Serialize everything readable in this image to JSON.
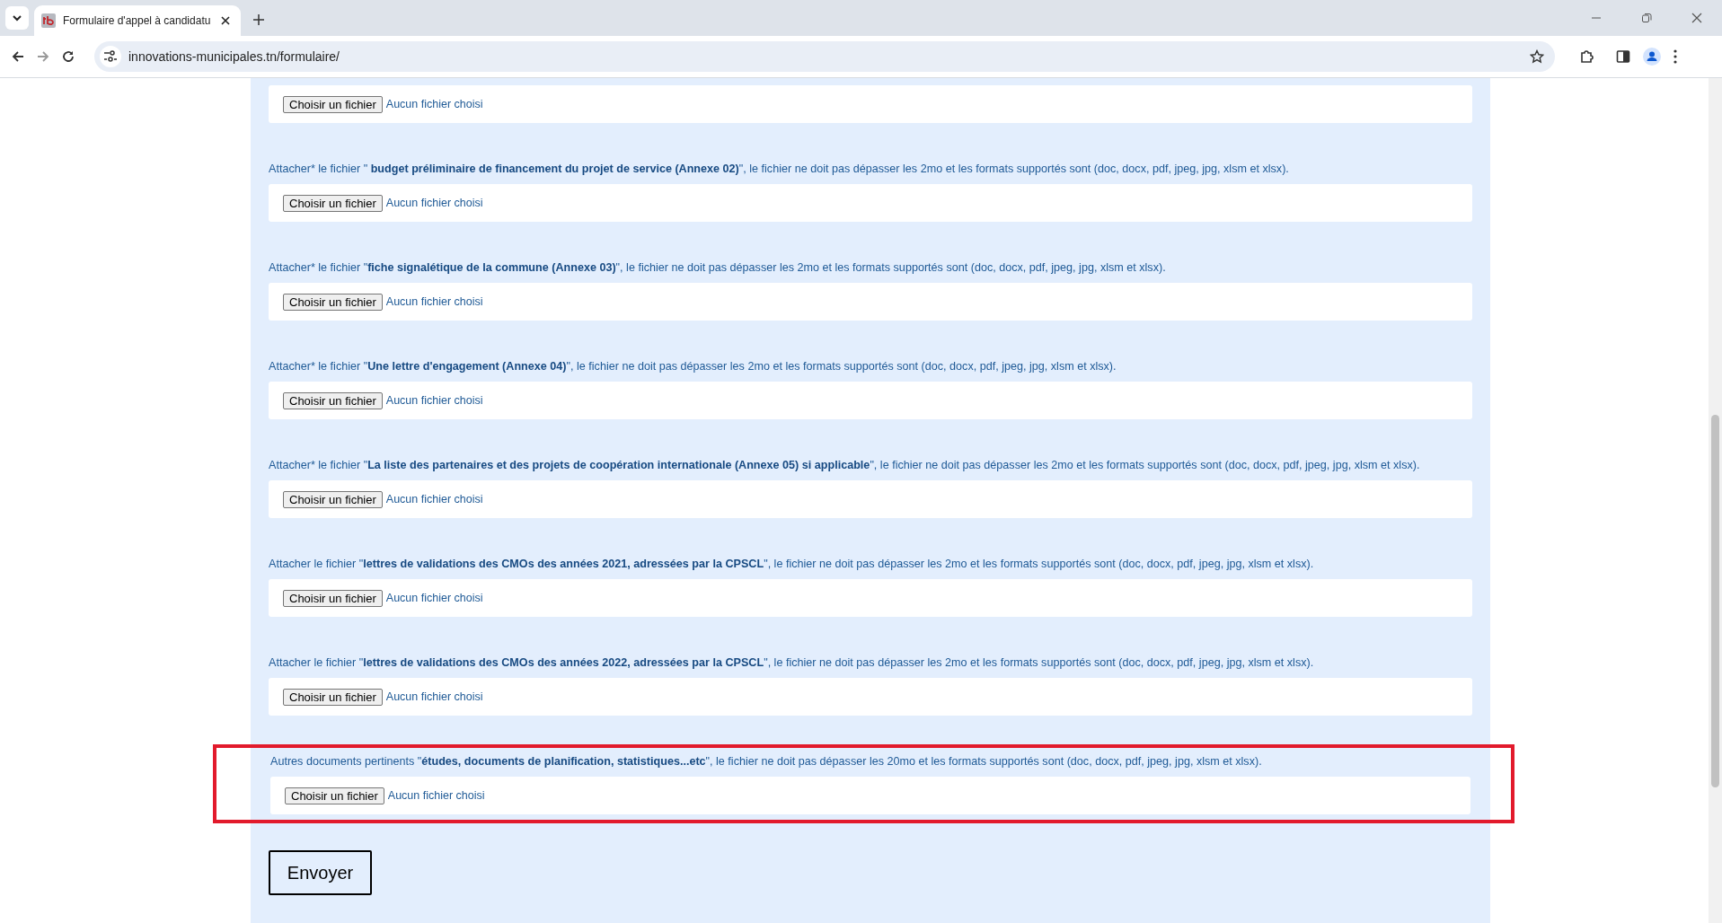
{
  "browser": {
    "tab_title": "Formulaire d'appel à candidatu",
    "url": "innovations-municipales.tn/formulaire/"
  },
  "fields": [
    {
      "button": "Choisir un fichier",
      "status": "Aucun fichier choisi",
      "highlighted": false
    },
    {
      "label": "Attacher* le fichier \" **budget préliminaire de financement du projet de service (Annexe 02)**\", le fichier ne doit pas dépasser les 2mo et les formats supportés sont (doc, docx, pdf, jpeg, jpg, xlsm et xlsx).",
      "button": "Choisir un fichier",
      "status": "Aucun fichier choisi",
      "highlighted": false
    },
    {
      "label": "Attacher* le fichier \"**fiche signalétique de la commune (Annexe 03)**\", le fichier ne doit pas dépasser les 2mo et les formats supportés sont (doc, docx, pdf, jpeg, jpg, xlsm et xlsx).",
      "button": "Choisir un fichier",
      "status": "Aucun fichier choisi",
      "highlighted": false
    },
    {
      "label": "Attacher* le fichier \"**Une lettre d'engagement (Annexe 04)**\", le fichier ne doit pas dépasser les 2mo et les formats supportés sont (doc, docx, pdf, jpeg, jpg, xlsm et xlsx).",
      "button": "Choisir un fichier",
      "status": "Aucun fichier choisi",
      "highlighted": false
    },
    {
      "label": "Attacher* le fichier \"**La liste des partenaires et des projets de coopération internationale (Annexe 05) si applicable**\", le fichier ne doit pas dépasser les 2mo et les formats supportés sont (doc, docx, pdf, jpeg, jpg, xlsm et xlsx).",
      "button": "Choisir un fichier",
      "status": "Aucun fichier choisi",
      "highlighted": false
    },
    {
      "label": "Attacher le fichier \"**lettres de validations des CMOs des années 2021, adressées par la CPSCL**\", le fichier ne doit pas dépasser les 2mo et les formats supportés sont (doc, docx, pdf, jpeg, jpg, xlsm et xlsx).",
      "button": "Choisir un fichier",
      "status": "Aucun fichier choisi",
      "highlighted": false
    },
    {
      "label": "Attacher le fichier \"**lettres de validations des CMOs des années 2022, adressées par la CPSCL**\", le fichier ne doit pas dépasser les 2mo et les formats supportés sont (doc, docx, pdf, jpeg, jpg, xlsm et xlsx).",
      "button": "Choisir un fichier",
      "status": "Aucun fichier choisi",
      "highlighted": false
    },
    {
      "label": "Autres documents pertinents \"**études, documents de planification, statistiques...etc**\", le fichier ne doit pas dépasser les 20mo et les formats supportés sont (doc, docx, pdf, jpeg, jpg, xlsm et xlsx).",
      "button": "Choisir un fichier",
      "status": "Aucun fichier choisi",
      "highlighted": true
    }
  ],
  "submit": "Envoyer"
}
